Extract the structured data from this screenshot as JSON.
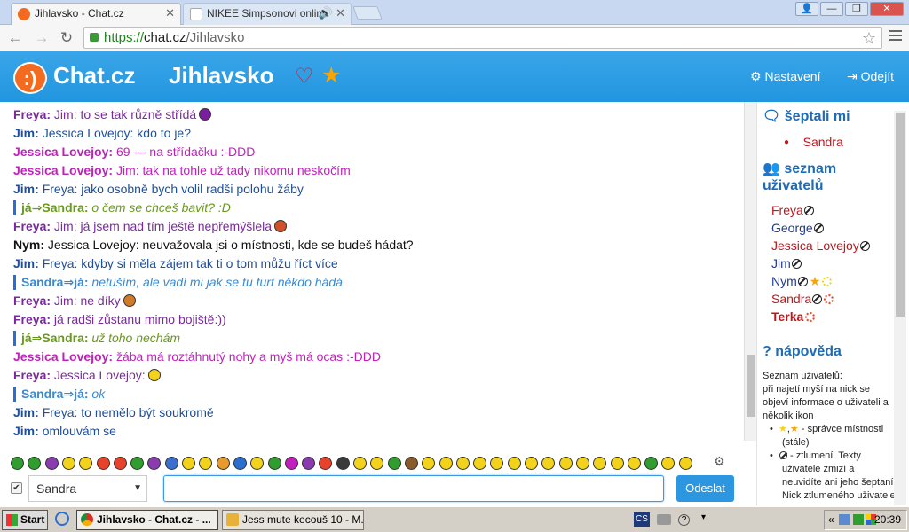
{
  "browser": {
    "tabs": [
      {
        "title": "Jihlavsko - Chat.cz",
        "active": true
      },
      {
        "title": "NIKEE Simpsonovi online",
        "active": false
      }
    ],
    "window_controls": [
      "👤",
      "—",
      "❐",
      "✕"
    ],
    "url_scheme": "https://",
    "url_host": "chat.cz",
    "url_path": "/Jihlavsko"
  },
  "header": {
    "brand": "Chat.cz",
    "room": "Jihlavsko",
    "settings_label": "Nastavení",
    "logout_label": "Odejít"
  },
  "messages": [
    {
      "from": "Freya:",
      "text": "Jim: to se tak různě střídá",
      "color": "#7a2a9c",
      "emoji": "#7a1fa0"
    },
    {
      "from": "Jim:",
      "text": "Jessica Lovejoy: kdo to je?",
      "color": "#1f4e9a"
    },
    {
      "from": "Jessica Lovejoy:",
      "text": "69 --- na střídačku :-DDD",
      "color": "#c21fbd"
    },
    {
      "from": "Jessica Lovejoy:",
      "text": "Jim: tak na tohle už tady nikomu neskočím",
      "color": "#c21fbd"
    },
    {
      "from": "Jim:",
      "text": "Freya: jako osobně bych volil radši polohu žáby",
      "color": "#1f4e9a"
    },
    {
      "whisper": true,
      "from": "já⇒Sandra:",
      "text": "o čem se chceš bavit? :D",
      "color": "#6a9a1a"
    },
    {
      "from": "Freya:",
      "text": "Jim: já jsem nad tím ještě nepřemýšlela",
      "color": "#7a2a9c",
      "emoji": "#d0502a"
    },
    {
      "from": "Nym:",
      "text": "Jessica Lovejoy: neuvažovala jsi o místnosti, kde se budeš hádat?",
      "color": "#111111"
    },
    {
      "from": "Jim:",
      "text": "Freya: kdyby si měla zájem tak ti o tom můžu říct více",
      "color": "#1f4e9a"
    },
    {
      "whisper": true,
      "from": "Sandra⇒já:",
      "text": "netuším, ale vadí mi jak se tu furt někdo hádá",
      "color": "#3a8ad0"
    },
    {
      "from": "Freya:",
      "text": "Jim: ne díky",
      "color": "#7a2a9c",
      "emoji": "#d07a2a"
    },
    {
      "from": "Freya:",
      "text": "já radši zůstanu mimo bojiště:))",
      "color": "#7a2a9c"
    },
    {
      "whisper": true,
      "from": "já⇒Sandra:",
      "text": "už toho nechám",
      "color": "#6a9a1a"
    },
    {
      "from": "Jessica Lovejoy:",
      "text": "žába má roztáhnutý nohy a myš má ocas :-DDD",
      "color": "#c21fbd"
    },
    {
      "from": "Freya:",
      "text": "Jessica Lovejoy:",
      "color": "#7a2a9c",
      "emoji": "#f2d21a"
    },
    {
      "whisper": true,
      "from": "Sandra⇒já:",
      "text": "ok",
      "color": "#3a8ad0"
    },
    {
      "from": "Jim:",
      "text": "Freya: to nemělo být soukromě",
      "color": "#1f4e9a"
    },
    {
      "from": "Jim:",
      "text": "omlouvám se",
      "color": "#1f4e9a"
    }
  ],
  "sidebar": {
    "whispered_title": "šeptali mi",
    "whispered": [
      "Sandra"
    ],
    "users_title": "seznam uživatelů",
    "users": [
      {
        "name": "Freya",
        "color": "#c0161c",
        "mute": true
      },
      {
        "name": "George",
        "color": "#1f3a9a",
        "mute": true
      },
      {
        "name": "Jessica Lovejoy",
        "color": "#c0161c",
        "mute": true
      },
      {
        "name": "Jim",
        "color": "#1f3a9a",
        "mute": true
      },
      {
        "name": "Nym",
        "color": "#1f3a9a",
        "mute": true,
        "star": true,
        "sun": "#f5d21a"
      },
      {
        "name": "Sandra",
        "color": "#c0161c",
        "mute": true,
        "sun": "#e8432a"
      },
      {
        "name": "Terka",
        "color": "#c0161c",
        "bold": true,
        "sun": "#e8432a"
      }
    ],
    "help_title": "nápověda",
    "help_intro": "Seznam uživatelů:",
    "help_lines": [
      "při najetí myší na nick se",
      "objeví informace o uživateli a",
      "několik ikon"
    ],
    "help_items": [
      [
        "- správce místnosti",
        "(stále)"
      ],
      [
        "- ztlumení. Texty",
        "uživatele zmizí a",
        "neuvidíte ani jeho šeptaní.",
        "Nick ztlumeného uživatele"
      ]
    ]
  },
  "input": {
    "recipient": "Sandra",
    "send_label": "Odeslat",
    "message_value": ""
  },
  "taskbar": {
    "start_label": "Start",
    "tasks": [
      {
        "title": "Jihlavsko - Chat.cz - ...",
        "active": true
      },
      {
        "title": "Jess mute kecouš 10 - M...",
        "active": false
      }
    ],
    "lang": "CS",
    "clock": "20:39"
  },
  "colors": {
    "accent": "#2196e0",
    "header_bg": "#2a9be3",
    "sidebar_title": "#1e6cb8",
    "emoji_palette": [
      "#2f9e2f",
      "#2f9e2f",
      "#8a3bb0",
      "#f2d21a",
      "#f2d21a",
      "#e8432a",
      "#e8432a",
      "#2f9e2f",
      "#8a3bb0",
      "#3a6fd0",
      "#f2d21a",
      "#f2d21a",
      "#e89a2a",
      "#2a6fd0",
      "#f2d21a",
      "#2f9e2f",
      "#c21fbd",
      "#8a3bb0",
      "#e8432a",
      "#3a3a3a",
      "#f2d21a",
      "#f2d21a",
      "#2f9e2f",
      "#8a5a2a",
      "#f2d21a",
      "#f2d21a",
      "#f2d21a",
      "#f2d21a",
      "#f2d21a",
      "#f2d21a",
      "#f2d21a",
      "#f2d21a",
      "#f2d21a",
      "#f2d21a",
      "#f2d21a",
      "#f2d21a",
      "#f2d21a",
      "#2f9e2f",
      "#f2d21a",
      "#f2d21a"
    ]
  }
}
